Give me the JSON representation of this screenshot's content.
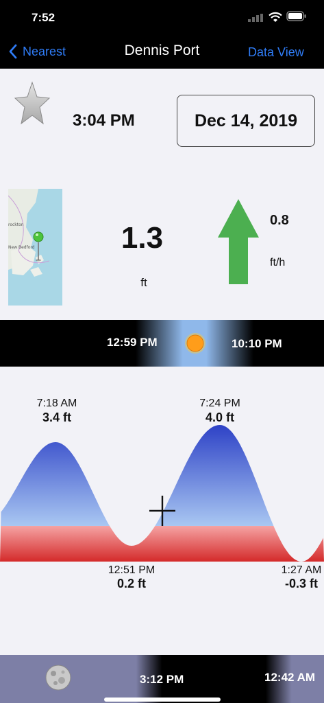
{
  "status": {
    "time": "7:52"
  },
  "nav": {
    "back_label": "Nearest",
    "title": "Dennis Port",
    "right_label": "Data View"
  },
  "info": {
    "current_time": "3:04 PM",
    "date": "Dec 14, 2019",
    "tide_height": "1.3",
    "tide_height_unit": "ft",
    "rate": "0.8",
    "rate_unit": "ft/h",
    "rate_direction": "rising"
  },
  "map": {
    "labels": [
      "rockton",
      "New Bedford"
    ]
  },
  "sun": {
    "sunrise": "12:59 PM",
    "sunset": "10:10 PM",
    "icon": "sun-icon"
  },
  "tides": [
    {
      "time": "7:18 AM",
      "height": "3.4 ft",
      "type": "high"
    },
    {
      "time": "12:51 PM",
      "height": "0.2 ft",
      "type": "low"
    },
    {
      "time": "7:24 PM",
      "height": "4.0 ft",
      "type": "high"
    },
    {
      "time": "1:27 AM",
      "height": "-0.3 ft",
      "type": "low"
    }
  ],
  "moon": {
    "moonrise": "3:12 PM",
    "moonset": "12:42 AM",
    "icon": "moon-icon"
  },
  "colors": {
    "accent": "#2f7cf6",
    "arrow": "#4caf50",
    "tide_high": "#1c2fc0",
    "tide_low": "#d42a2a"
  }
}
